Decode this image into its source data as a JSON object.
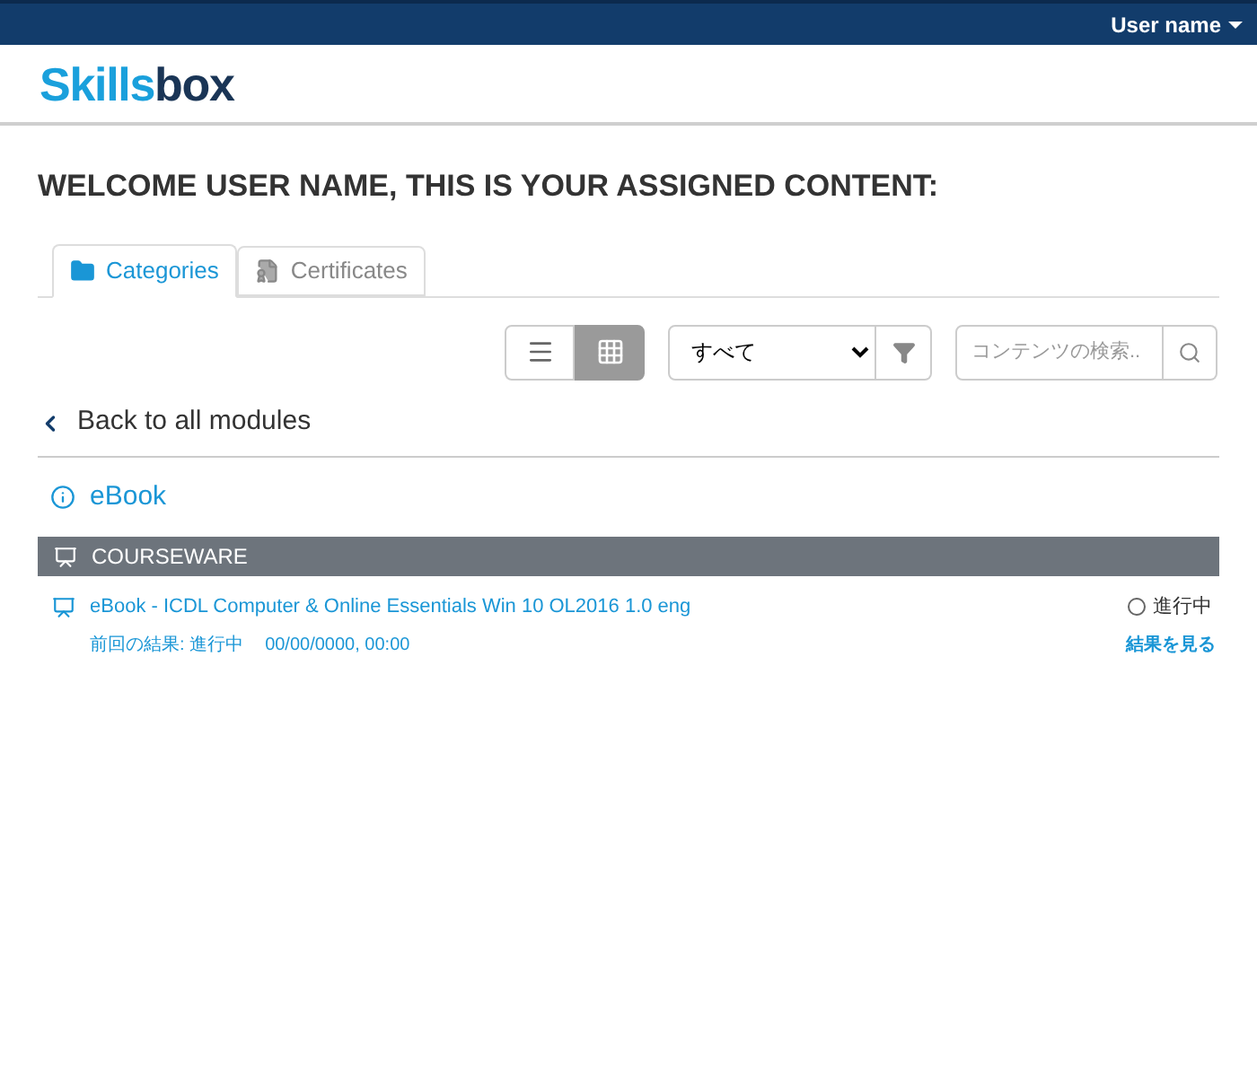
{
  "top_bar": {
    "user_menu": "User name"
  },
  "logo": {
    "part_1": "Skills",
    "part_2": "box"
  },
  "heading": "WELCOME USER NAME, THIS IS YOUR ASSIGNED CONTENT:",
  "tabs": [
    {
      "label": "Categories",
      "selected": true,
      "kind": "folder"
    },
    {
      "label": "Certificates",
      "selected": false,
      "kind": "certificate"
    }
  ],
  "toolbar": {
    "views": [
      {
        "kind": "list",
        "selected": false
      },
      {
        "kind": "grid",
        "selected": true
      }
    ],
    "filter_value": "すべて",
    "search": {
      "placeholder": "コンテンツの検索.."
    }
  },
  "back_link": "Back to all modules",
  "module_title": "eBook",
  "section": {
    "title": "COURSEWARE",
    "items": [
      {
        "title": "eBook - ICDL Computer & Online Essentials Win 10 OL2016 1.0 eng",
        "status": "進行中",
        "last_result": "前回の結果: 進行中",
        "date": "00/00/0000, 00:00",
        "link": "結果を見る"
      }
    ]
  }
}
